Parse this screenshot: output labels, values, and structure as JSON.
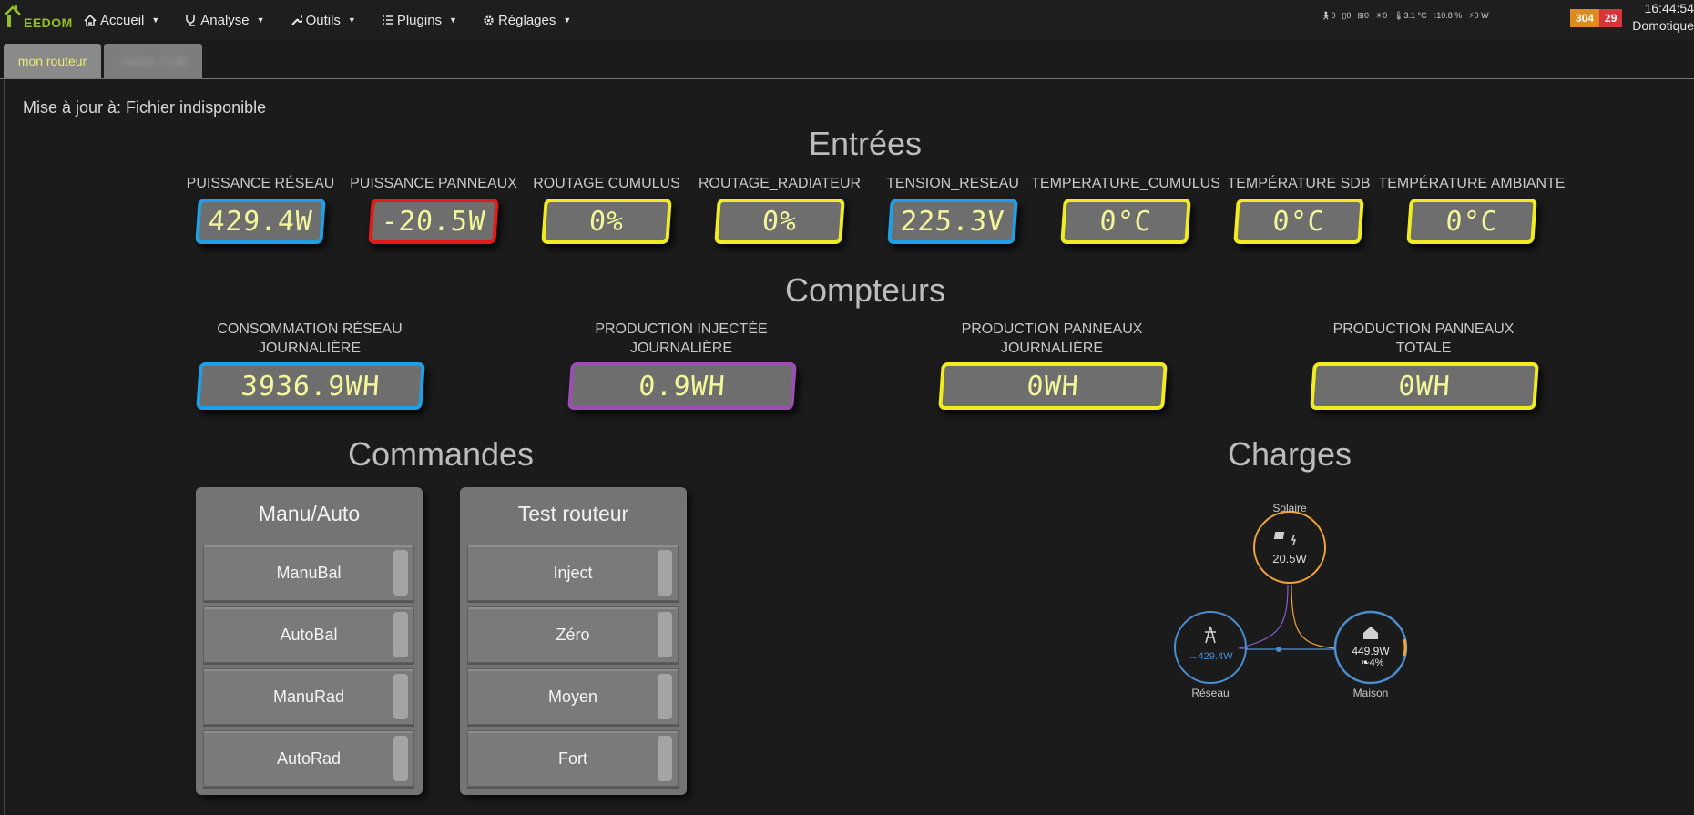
{
  "navbar": {
    "logo_text": "EEDOM",
    "menu": [
      {
        "label": "Accueil",
        "icon": "home-icon"
      },
      {
        "label": "Analyse",
        "icon": "stethoscope-icon"
      },
      {
        "label": "Outils",
        "icon": "wrench-icon"
      },
      {
        "label": "Plugins",
        "icon": "list-icon"
      },
      {
        "label": "Réglages",
        "icon": "gear-icon"
      }
    ],
    "status": [
      {
        "icon": "motion-icon",
        "value": "0"
      },
      {
        "icon": "door-icon",
        "value": "0"
      },
      {
        "icon": "window-icon",
        "value": "0"
      },
      {
        "icon": "light-icon",
        "value": "0"
      },
      {
        "icon": "thermometer-icon",
        "value": "3.1 °C"
      },
      {
        "icon": "humidity-icon",
        "value": "10.8 %"
      },
      {
        "icon": "power-icon",
        "value": "0 W"
      }
    ],
    "badge_orange": "304",
    "badge_red": "29",
    "time": "16:44:54",
    "user": "Domotique",
    "colors": {
      "badge_orange": "#e08a1e",
      "badge_red": "#d9343a",
      "logo": "#94c11f"
    }
  },
  "tabs": [
    {
      "label": "mon routeur",
      "active": true
    },
    {
      "label": "Atelier CUB",
      "active": false
    }
  ],
  "main": {
    "update_status": "Mise à jour à: Fichier indisponible",
    "entrees_title": "Entrées",
    "entrees": [
      {
        "label": "PUISSANCE RÉSEAU",
        "value": "429.4W",
        "color": "#1ea0e6"
      },
      {
        "label": "PUISSANCE PANNEAUX",
        "value": "-20.5W",
        "color": "#e61919"
      },
      {
        "label": "ROUTAGE CUMULUS",
        "value": "0%",
        "color": "#f0ec1e"
      },
      {
        "label": "ROUTAGE_RADIATEUR",
        "value": "0%",
        "color": "#f0ec1e"
      },
      {
        "label": "TENSION_RESEAU",
        "value": "225.3V",
        "color": "#1ea0e6"
      },
      {
        "label": "TEMPERATURE_CUMULUS",
        "value": "0°C",
        "color": "#f0ec1e"
      },
      {
        "label": "TEMPÉRATURE SDB",
        "value": "0°C",
        "color": "#f0ec1e"
      },
      {
        "label": "TEMPÉRATURE AMBIANTE",
        "value": "0°C",
        "color": "#f0ec1e"
      }
    ],
    "compteurs_title": "Compteurs",
    "compteurs": [
      {
        "label_line1": "CONSOMMATION RÉSEAU",
        "label_line2": "JOURNALIÈRE",
        "value": "3936.9WH",
        "color": "#1ea0e6"
      },
      {
        "label_line1": "PRODUCTION INJECTÉE",
        "label_line2": "JOURNALIÈRE",
        "value": "0.9WH",
        "color": "#9b4fb4"
      },
      {
        "label_line1": "PRODUCTION PANNEAUX",
        "label_line2": "JOURNALIÈRE",
        "value": "0WH",
        "color": "#f0ec1e"
      },
      {
        "label_line1": "PRODUCTION PANNEAUX",
        "label_line2": "TOTALE",
        "value": "0WH",
        "color": "#f0ec1e"
      }
    ],
    "commandes_title": "Commandes",
    "panels": [
      {
        "title": "Manu/Auto",
        "buttons": [
          "ManuBal",
          "AutoBal",
          "ManuRad",
          "AutoRad"
        ]
      },
      {
        "title": "Test routeur",
        "buttons": [
          "Inject",
          "Zéro",
          "Moyen",
          "Fort"
        ]
      }
    ],
    "charges_title": "Charges",
    "power_flow": {
      "solar_label": "Solaire",
      "solar_value": "20.5W",
      "grid_label": "Réseau",
      "grid_value": "→429.4W",
      "home_label": "Maison",
      "home_value": "449.9W",
      "home_percent": "4%",
      "colors": {
        "solar": "#f2a33a",
        "grid": "#4b8fd0",
        "home": "#4b8fd0"
      }
    }
  }
}
